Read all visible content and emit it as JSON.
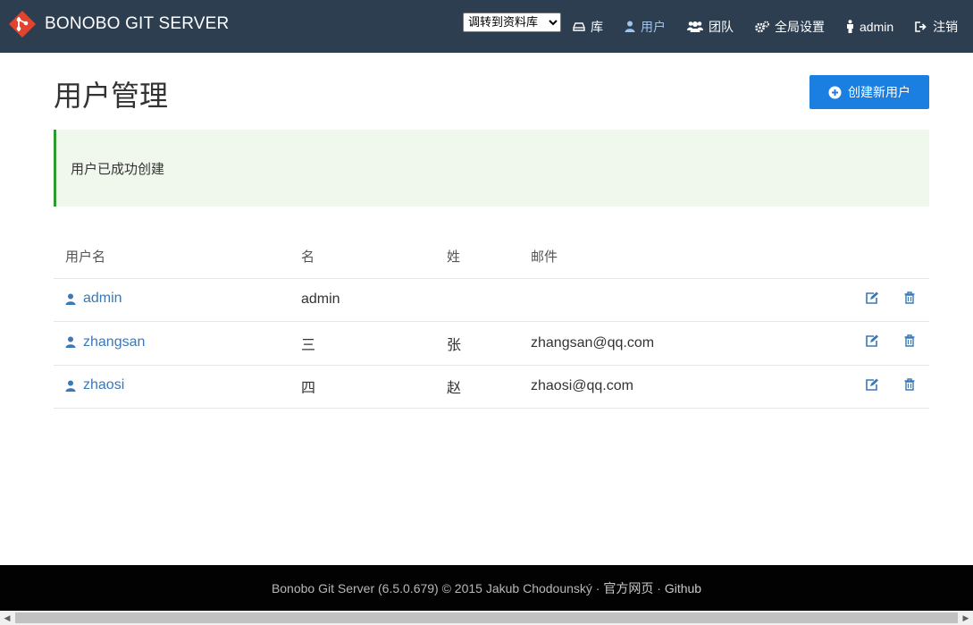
{
  "app": {
    "brand": "BONOBO GIT SERVER",
    "colors": {
      "navbar": "#2d3e50",
      "primary": "#1a7fe0",
      "link": "#3a78b8",
      "success_border": "#2f9a2f",
      "footer": "#020202"
    }
  },
  "nav": {
    "repo_select": {
      "selected": "调转到资料库"
    },
    "items": [
      {
        "label": "库",
        "icon": "repository-icon"
      },
      {
        "label": "用户",
        "icon": "user-icon",
        "active": true
      },
      {
        "label": "团队",
        "icon": "team-icon"
      },
      {
        "label": "全局设置",
        "icon": "settings-icon"
      },
      {
        "label": "admin",
        "icon": "person-icon"
      },
      {
        "label": "注销",
        "icon": "logout-icon"
      }
    ]
  },
  "page": {
    "title": "用户管理",
    "create_button": "创建新用户",
    "alert": "用户已成功创建"
  },
  "table": {
    "headers": [
      "用户名",
      "名",
      "姓",
      "邮件"
    ],
    "rows": [
      {
        "username": "admin",
        "first": "admin",
        "last": "",
        "email": ""
      },
      {
        "username": "zhangsan",
        "first": "三",
        "last": "张",
        "email": "zhangsan@qq.com"
      },
      {
        "username": "zhaosi",
        "first": "四",
        "last": "赵",
        "email": "zhaosi@qq.com"
      }
    ]
  },
  "footer": {
    "text": "Bonobo Git Server (6.5.0.679) © 2015 Jakub Chodounský · ",
    "link1": "官方网页",
    "sep": " · ",
    "link2": "Github"
  }
}
